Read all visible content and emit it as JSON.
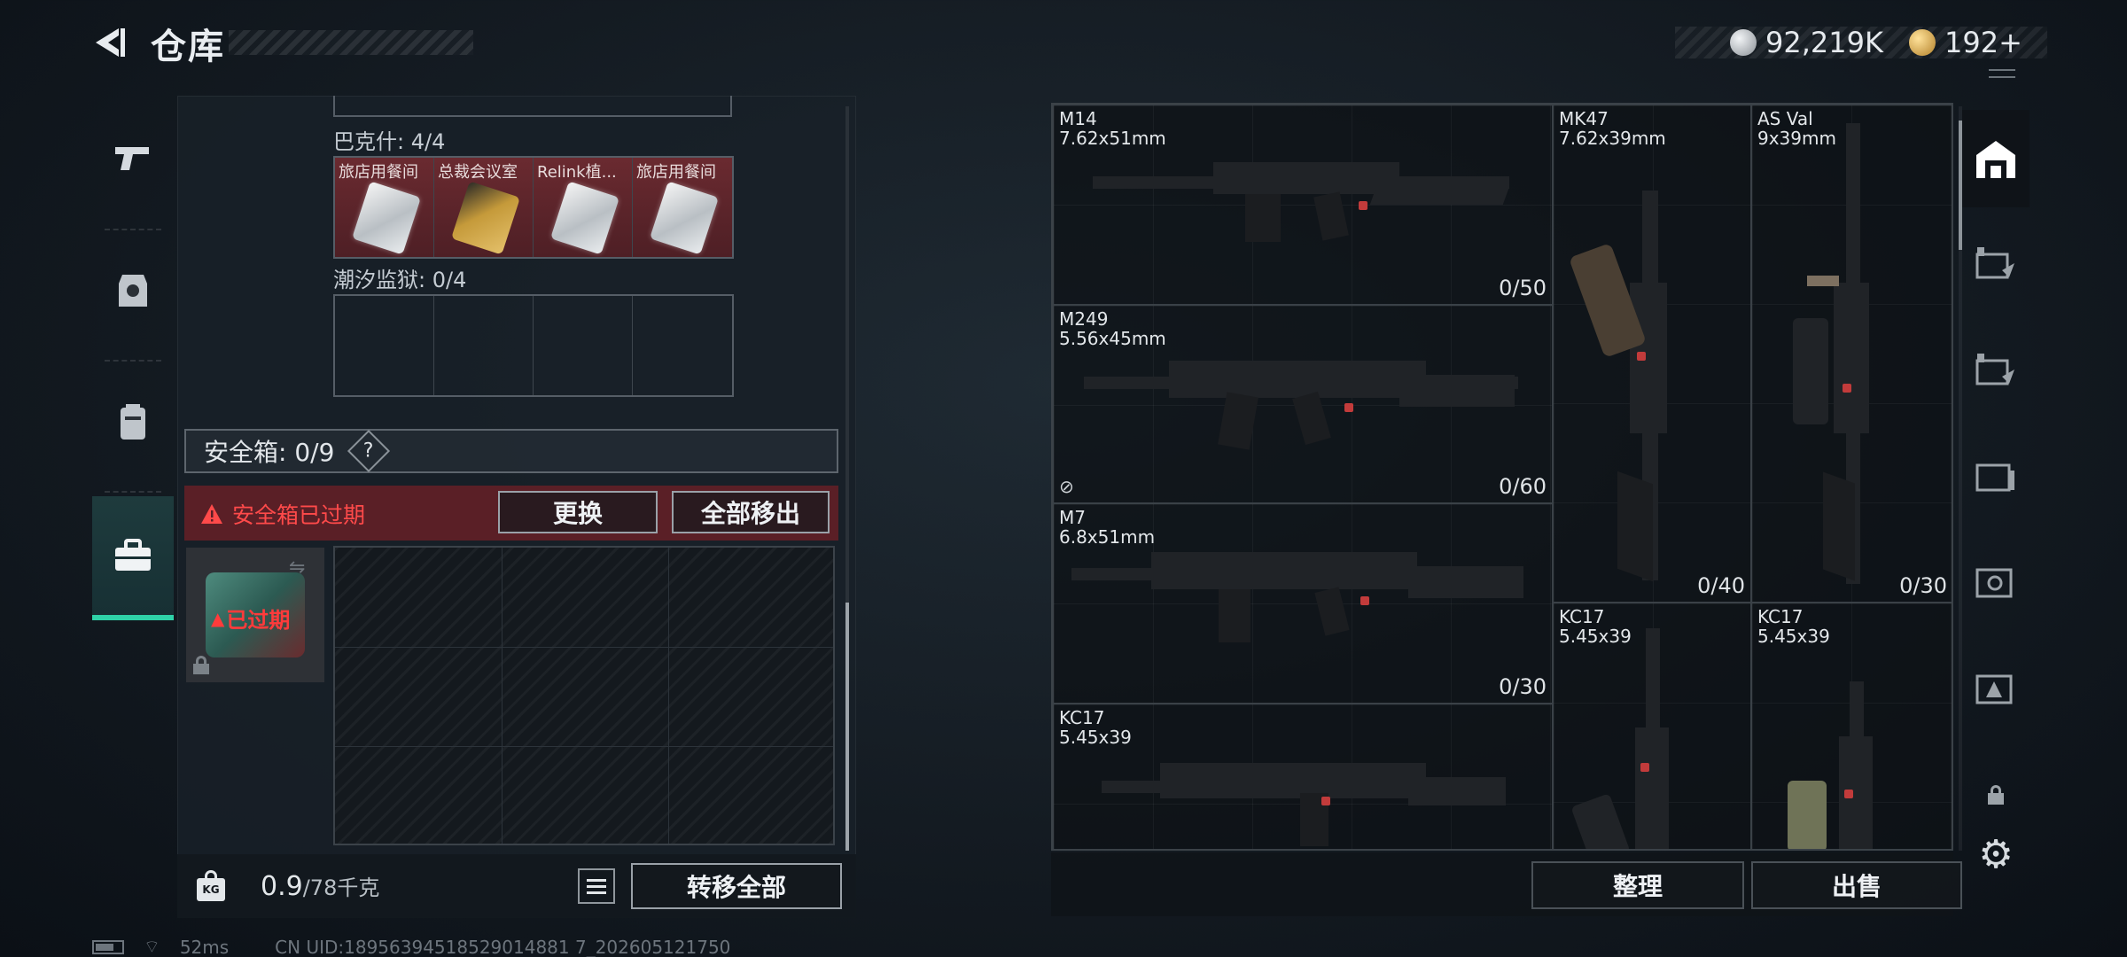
{
  "header": {
    "title": "仓库",
    "currency_1": "92,219K",
    "currency_2": "192+"
  },
  "left_panel": {
    "group_bakeshi": {
      "label": "巴克什: 4/4",
      "slots": [
        "旅店用餐间",
        "总裁会议室",
        "Relink植...",
        "旅店用餐间"
      ]
    },
    "group_chaoxi": {
      "label": "潮汐监狱: 0/4"
    },
    "safebox": {
      "title": "安全箱: 0/9",
      "help": "?",
      "expired_warning": "安全箱已过期",
      "replace_button": "更换",
      "move_all_button": "全部移出",
      "expired_badge": "已过期"
    },
    "bottom": {
      "weight_current": "0.9",
      "weight_total": "/78千克",
      "kg_icon_label": "KG",
      "transfer_all_button": "转移全部"
    }
  },
  "weapons": [
    {
      "name": "M14",
      "caliber": "7.62x51mm",
      "count": "0/50"
    },
    {
      "name": "MK47",
      "caliber": "7.62x39mm",
      "count": "0/40"
    },
    {
      "name": "AS Val",
      "caliber": "9x39mm",
      "count": "0/30"
    },
    {
      "name": "M249",
      "caliber": "5.56x45mm",
      "count": "0/60"
    },
    {
      "name": "M7",
      "caliber": "6.8x51mm",
      "count": "0/30"
    },
    {
      "name": "KC17",
      "caliber": "5.45x39",
      "count": ""
    },
    {
      "name": "KC17",
      "caliber": "5.45x39",
      "count": ""
    },
    {
      "name": "KC17",
      "caliber": "5.45x39",
      "count": ""
    }
  ],
  "right_bottom": {
    "sort_button": "整理",
    "sell_button": "出售"
  },
  "status": {
    "ping": "52ms",
    "uid": "CN UID:18956394518529014881 7_202605121750"
  },
  "colors": {
    "accent_green": "#2fd2a8",
    "warning_red": "#ff4a4a",
    "expired_bg": "#5a1f26",
    "slot_red": "#6a2a30"
  }
}
